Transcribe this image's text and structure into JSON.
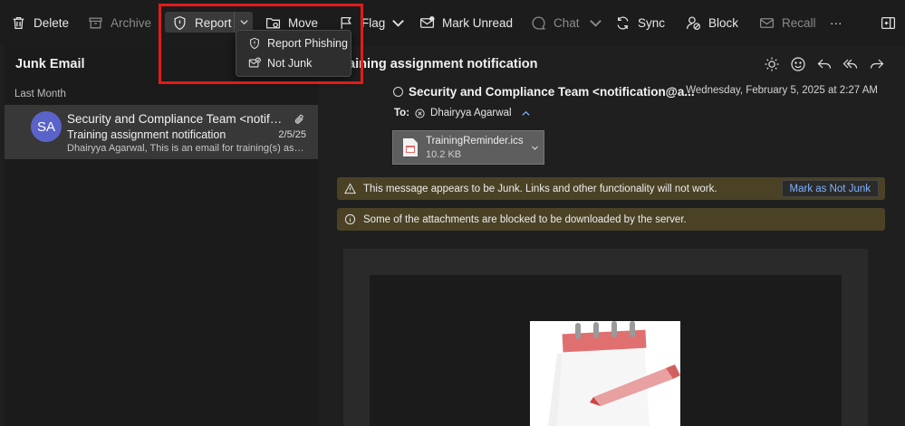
{
  "toolbar": {
    "delete_label": "Delete",
    "archive_label": "Archive",
    "report_label": "Report",
    "move_label": "Move",
    "flag_label": "Flag",
    "mark_unread_label": "Mark Unread",
    "chat_label": "Chat",
    "sync_label": "Sync",
    "block_label": "Block",
    "recall_label": "Recall",
    "more_label": "···"
  },
  "report_menu": {
    "items": [
      {
        "label": "Report Phishing",
        "icon": "shield-icon"
      },
      {
        "label": "Not Junk",
        "icon": "mail-check-icon"
      }
    ]
  },
  "folder": {
    "title": "Junk Email",
    "group_label": "Last Month"
  },
  "message_list": [
    {
      "initials": "SA",
      "sender": "Security and Compliance Team <notification@aeroa.onmicrosoft.com>",
      "subject": "Training assignment notification",
      "date": "2/5/25",
      "preview": "Dhairyya Agarwal, This is an email for training(s) assigned to you.",
      "has_attachment": true
    }
  ],
  "reading": {
    "subject": "Training assignment notification",
    "subject_visible": "aining assignment notification",
    "from": "Security and Compliance Team <notification@a...",
    "date": "Wednesday, February 5, 2025 at 2:27 AM",
    "to_label": "To:",
    "to_name": "Dhairyya Agarwal",
    "attachment": {
      "name": "TrainingReminder.ics",
      "size": "10.2 KB"
    },
    "junk_warning": "This message appears to be Junk. Links and other functionality will not work.",
    "not_junk_button": "Mark as Not Junk",
    "blocked_notice": "Some of the attachments are blocked to be downloaded by the server."
  },
  "colors": {
    "accent_avatar": "#5a63c9",
    "warning_bar": "#4b4226",
    "link_blue": "#7fb2ff",
    "highlight_box": "#e01b1b"
  }
}
